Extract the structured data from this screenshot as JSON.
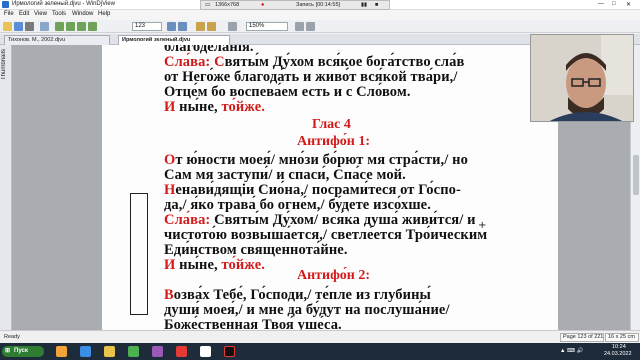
{
  "window": {
    "title": "Ирмологий зеленый.djvu - WinDjView",
    "controls": [
      "—",
      "□",
      "✕"
    ]
  },
  "recorder": {
    "resolution": "1366x768",
    "record_label": "Запись [00:14:55]"
  },
  "menu": [
    "File",
    "Edit",
    "View",
    "Tools",
    "Window",
    "Help"
  ],
  "toolbar": {
    "page_field": "123",
    "zoom_field": "150%"
  },
  "tabs": [
    {
      "label": "Тихонов. М., 2002.djvu"
    },
    {
      "label": "Ирмологий зеленый.djvu"
    }
  ],
  "sidebar": {
    "thumbnails_label": "Thumbnails"
  },
  "document": {
    "lines_top": [
      {
        "segments": [
          {
            "t": "благоде́ланiя.",
            "red": false
          }
        ]
      },
      {
        "segments": [
          {
            "t": "Сла́ва: ",
            "red": true
          },
          {
            "t": "С",
            "red": true
          },
          {
            "t": "вяты́м Ду́хом вся́кое бога́тство сла́в",
            "red": false
          }
        ]
      },
      {
        "segments": [
          {
            "t": "от Него́же благода́ть и живо́т вся́кой тва́ри,/",
            "red": false
          }
        ]
      },
      {
        "segments": [
          {
            "t": "Отце́м бо воспева́ем есть и с Сло́вом.",
            "red": false
          }
        ]
      },
      {
        "segments": [
          {
            "t": "И ",
            "red": true
          },
          {
            "t": "ны́не, ",
            "red": false
          },
          {
            "t": "то́йже.",
            "red": true
          }
        ]
      }
    ],
    "glas_heading": "Глас 4",
    "antiphon1_heading": "Антифо́н 1:",
    "lines_mid": [
      {
        "segments": [
          {
            "t": "О",
            "red": true
          },
          {
            "t": "т ю́ности моея́/ мно́зи бо́рют мя стра́сти,/ но",
            "red": false
          }
        ]
      },
      {
        "segments": [
          {
            "t": "Сам мя заступи́/ и спаси́, Спа́се мой.",
            "red": false
          }
        ]
      },
      {
        "segments": [
          {
            "t": "Н",
            "red": true
          },
          {
            "t": "енави́дящiи Сио́на,/ посрами́тeся от Го́спо-",
            "red": false
          }
        ]
      },
      {
        "segments": [
          {
            "t": "да,/ я́ко трава́ бо огне́м,/ бу́дете изсо́хше.",
            "red": false
          }
        ]
      },
      {
        "segments": [
          {
            "t": "Сла́ва: ",
            "red": true
          },
          {
            "t": "Святы́м Ду́хом/ вся́ка душа́ живи́тся/ и",
            "red": false
          }
        ]
      },
      {
        "segments": [
          {
            "t": "чистото́ю возвыша́ется,/ светле́ется Тро́ическим",
            "red": false
          }
        ]
      },
      {
        "segments": [
          {
            "t": "Еди́нством священнота́йне.",
            "red": false
          }
        ]
      },
      {
        "segments": [
          {
            "t": "И ",
            "red": true
          },
          {
            "t": "ны́не, ",
            "red": false
          },
          {
            "t": "то́йже.",
            "red": true
          }
        ]
      }
    ],
    "antiphon2_heading": "Антифо́н 2:",
    "lines_bottom": [
      {
        "segments": [
          {
            "t": "В",
            "red": true
          },
          {
            "t": "озва́х Тебе́, Го́споди,/ те́пле из глубины́",
            "red": false
          }
        ]
      },
      {
        "segments": [
          {
            "t": "души́ моея́,/ и мне да бу́дут на послуша́ние/",
            "red": false
          }
        ]
      },
      {
        "segments": [
          {
            "t": "Боже́ственная Твоя́ уше́са.",
            "red": false
          }
        ]
      }
    ]
  },
  "status": {
    "ready": "Ready",
    "page_info": "Page 123 of 221",
    "size_info": "16 x 25 cm"
  },
  "taskbar": {
    "start_label": "Пуск",
    "time": "10:24",
    "date": "24.03.2022"
  },
  "colors": {
    "accent_red": "#d21a1a",
    "taskbar": "#1e2b3a"
  }
}
